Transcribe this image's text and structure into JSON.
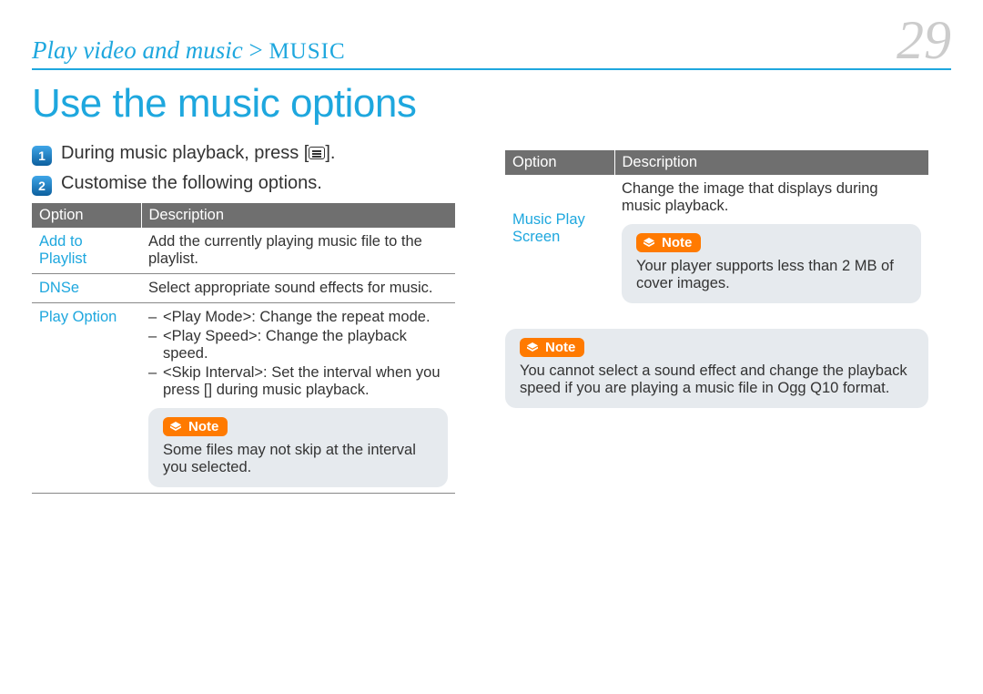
{
  "page_number": "29",
  "breadcrumb": {
    "section": "Play video and music",
    "sep": ">",
    "page": "MUSIC"
  },
  "title": "Use the music options",
  "steps": [
    {
      "num": "1",
      "pre": "During music playback, press [",
      "post": "]."
    },
    {
      "num": "2",
      "text": "Customise the following options."
    }
  ],
  "table_headers": {
    "option": "Option",
    "description": "Description"
  },
  "left_rows": {
    "add_to_playlist": {
      "option": "Add to Playlist",
      "desc": "Add the currently playing music file to the playlist."
    },
    "dnse": {
      "option": "DNSe",
      "desc": "Select appropriate sound effects for music."
    },
    "play_option": {
      "option": "Play Option",
      "items": {
        "a": "<Play Mode>: Change the repeat mode.",
        "b": "<Play Speed>: Change the playback speed.",
        "c_pre": "<Skip Interval>: Set the interval when you press [",
        "c_post": "] during music playback."
      },
      "note_label": "Note",
      "note_text": "Some files may not skip at the interval you selected."
    }
  },
  "right_rows": {
    "music_play_screen": {
      "option": "Music Play Screen",
      "desc": "Change the image that displays during music playback.",
      "note_label": "Note",
      "note_text": "Your player supports less than 2 MB of cover images."
    }
  },
  "footer_note": {
    "label": "Note",
    "text": "You cannot select a sound effect and change the playback speed if you are playing a music file in Ogg Q10 format."
  }
}
